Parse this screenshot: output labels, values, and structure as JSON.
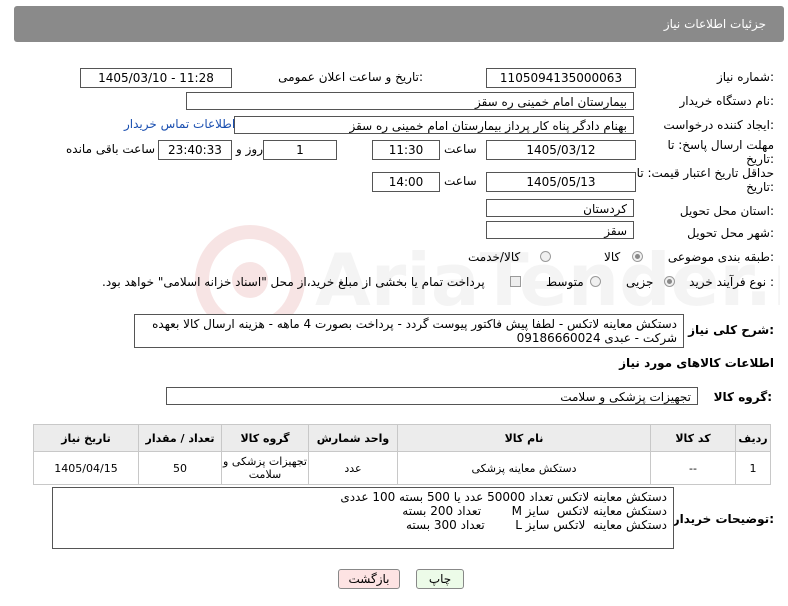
{
  "header": {
    "title": "جزئیات اطلاعات نیاز"
  },
  "form": {
    "need_number_label": "شماره نیاز:",
    "need_number": "1105094135000063",
    "announce_label": "تاریخ و ساعت اعلان عمومی:",
    "announce_value": "1405/03/10 - 11:28",
    "buyer_org_label": "نام دستگاه خریدار:",
    "buyer_org": "بیمارستان امام خمینی  ره  سقز",
    "requester_label": "ایجاد کننده درخواست:",
    "requester": "بهنام دادگر پناه کار پرداز بیمارستان امام خمینی  ره  سقز",
    "contact_link": "اطلاعات تماس خریدار",
    "deadline_label": "مهلت ارسال پاسخ: تا تاریخ:",
    "deadline_date": "1405/03/12",
    "time_label": "ساعت",
    "deadline_time": "11:30",
    "days_value": "1",
    "days_label": "روز و",
    "remaining_time": "23:40:33",
    "remaining_label": "ساعت باقی مانده",
    "validity_label": "حداقل تاریخ اعتبار قیمت: تا تاریخ:",
    "validity_date": "1405/05/13",
    "validity_time": "14:00",
    "province_label": "استان محل تحویل:",
    "province": "کردستان",
    "city_label": "شهر محل تحویل:",
    "city": "سقز",
    "category_label": "طبقه بندی موضوعی:",
    "category_options": [
      "کالا",
      "کالا/خدمت"
    ],
    "process_label": "نوع فرآیند خرید :",
    "process_options": [
      "جزیی",
      "متوسط"
    ],
    "payment_note": "پرداخت تمام یا بخشی از مبلغ خرید،از محل \"اسناد خزانه اسلامی\" خواهد بود."
  },
  "description": {
    "label": "شرح کلی نیاز:",
    "text": "دستکش معاینه لاتکس - لطفا پیش فاکتور پیوست گردد - پرداخت بصورت 4 ماهه - هزینه ارسال کالا بعهده شرکت - عبدی 09186660024"
  },
  "goods": {
    "section_title": "اطلاعات کالاهای مورد نیاز",
    "group_label": "گروه کالا:",
    "group_value": "تجهیزات پزشکی و سلامت",
    "columns": [
      "ردیف",
      "کد کالا",
      "نام کالا",
      "واحد شمارش",
      "گروه کالا",
      "تعداد / مقدار",
      "تاریخ نیاز"
    ],
    "rows": [
      {
        "row": "1",
        "code": "--",
        "name": "دستکش معاینه پزشکی",
        "unit": "عدد",
        "group": "تجهیزات پزشکی و سلامت",
        "qty": "50",
        "date": "1405/04/15"
      }
    ]
  },
  "buyer_notes": {
    "label": "توضیحات خریدار:",
    "lines": [
      "دستکش معاینه لاتکس تعداد 50000 عدد یا 500 بسته  100 عددی",
      "دستکش معاینه لاتکس  سایز M        تعداد 200 بسته",
      "دستکش معاینه  لاتکس سایز L        تعداد 300 بسته"
    ]
  },
  "buttons": {
    "print": "چاپ",
    "back": "بازگشت"
  },
  "watermark_text": "AriaTender.neT",
  "colors": {
    "header_bg": "#8a8a8a",
    "link": "#1a4fb0",
    "back_button_bg": "#fde3e3",
    "print_button_bg": "#ecfbe8"
  }
}
